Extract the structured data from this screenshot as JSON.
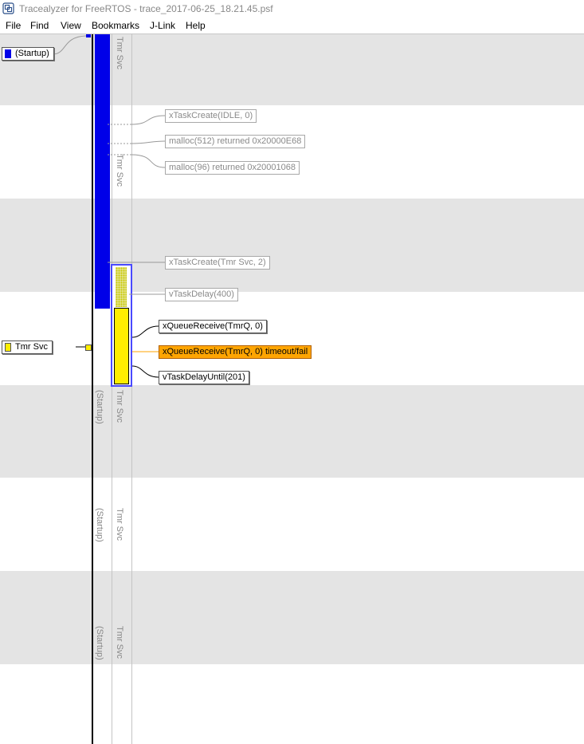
{
  "window": {
    "title": "Tracealyzer for FreeRTOS - trace_2017-06-25_18.21.45.psf"
  },
  "menu": [
    "File",
    "Find",
    "View",
    "Bookmarks",
    "J-Link",
    "Help"
  ],
  "tasks": [
    {
      "label": "(Startup)",
      "color": "#0000e8"
    },
    {
      "label": "Tmr Svc",
      "color": "#ffee00"
    }
  ],
  "columns": {
    "tmr_svc": "Tmr Svc",
    "startup": "(Startup)"
  },
  "events": [
    {
      "label": "xTaskCreate(IDLE, 0)",
      "state": "faded"
    },
    {
      "label": "malloc(512) returned 0x20000E68",
      "state": "faded"
    },
    {
      "label": "malloc(96) returned 0x20001068",
      "state": "faded"
    },
    {
      "label": "xTaskCreate(Tmr Svc, 2)",
      "state": "faded"
    },
    {
      "label": "vTaskDelay(400)",
      "state": "faded"
    },
    {
      "label": "xQueueReceive(TmrQ, 0)",
      "state": "active"
    },
    {
      "label": "xQueueReceive(TmrQ, 0) timeout/fail",
      "state": "fail"
    },
    {
      "label": "vTaskDelayUntil(201)",
      "state": "active"
    }
  ],
  "colors": {
    "startup_task": "#0000e8",
    "tmr_svc_task": "#ffee00",
    "fail_event": "#ffa500",
    "band": "#e4e4e4",
    "selection": "#4a4aff"
  }
}
